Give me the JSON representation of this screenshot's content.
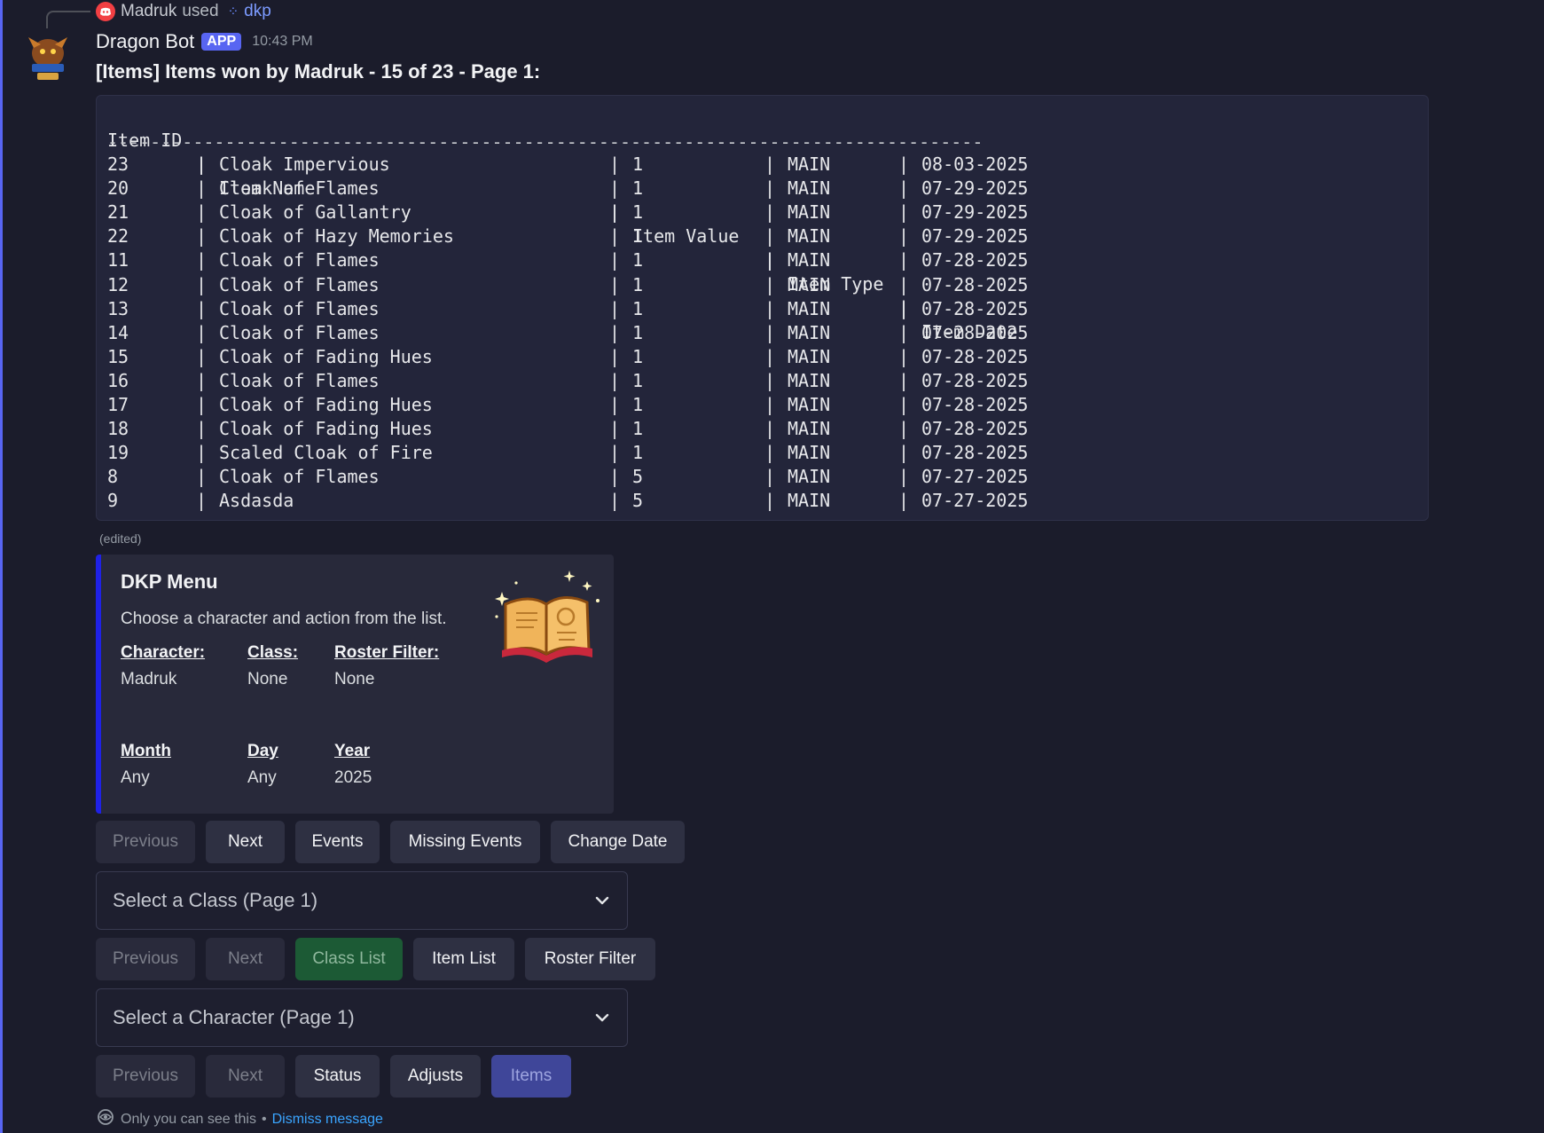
{
  "reply": {
    "user": "Madruk",
    "used_text": "used",
    "command": "dkp"
  },
  "message": {
    "bot_name": "Dragon Bot",
    "app_tag": "APP",
    "time": "10:43 PM",
    "title": "[Items] Items won by Madruk - 15 of 23 - Page 1:",
    "edited": "(edited)"
  },
  "table": {
    "headers": [
      "Item ID",
      "Item Name",
      "Item Value",
      "Item Type",
      "Item Date"
    ],
    "separator": "----------------------------------------------------------------------------------",
    "rows": [
      {
        "id": "23",
        "name": "Cloak Impervious",
        "value": "1",
        "type": "MAIN",
        "date": "08-03-2025"
      },
      {
        "id": "20",
        "name": "Cloak of Flames",
        "value": "1",
        "type": "MAIN",
        "date": "07-29-2025"
      },
      {
        "id": "21",
        "name": "Cloak of Gallantry",
        "value": "1",
        "type": "MAIN",
        "date": "07-29-2025"
      },
      {
        "id": "22",
        "name": "Cloak of Hazy Memories",
        "value": "1",
        "type": "MAIN",
        "date": "07-29-2025"
      },
      {
        "id": "11",
        "name": "Cloak of Flames",
        "value": "1",
        "type": "MAIN",
        "date": "07-28-2025"
      },
      {
        "id": "12",
        "name": "Cloak of Flames",
        "value": "1",
        "type": "MAIN",
        "date": "07-28-2025"
      },
      {
        "id": "13",
        "name": "Cloak of Flames",
        "value": "1",
        "type": "MAIN",
        "date": "07-28-2025"
      },
      {
        "id": "14",
        "name": "Cloak of Flames",
        "value": "1",
        "type": "MAIN",
        "date": "07-28-2025"
      },
      {
        "id": "15",
        "name": "Cloak of Fading Hues",
        "value": "1",
        "type": "MAIN",
        "date": "07-28-2025"
      },
      {
        "id": "16",
        "name": "Cloak of Flames",
        "value": "1",
        "type": "MAIN",
        "date": "07-28-2025"
      },
      {
        "id": "17",
        "name": "Cloak of Fading Hues",
        "value": "1",
        "type": "MAIN",
        "date": "07-28-2025"
      },
      {
        "id": "18",
        "name": "Cloak of Fading Hues",
        "value": "1",
        "type": "MAIN",
        "date": "07-28-2025"
      },
      {
        "id": "19",
        "name": "Scaled Cloak of Fire",
        "value": "1",
        "type": "MAIN",
        "date": "07-28-2025"
      },
      {
        "id": "8",
        "name": "Cloak of Flames",
        "value": "5",
        "type": "MAIN",
        "date": "07-27-2025"
      },
      {
        "id": "9",
        "name": "Asdasda",
        "value": "5",
        "type": "MAIN",
        "date": "07-27-2025"
      }
    ]
  },
  "embed": {
    "title": "DKP Menu",
    "description": "Choose a character and action from the list.",
    "accent_color": "#1f21e6",
    "fields": [
      {
        "name": "Character:",
        "value": "Madruk"
      },
      {
        "name": "Class:",
        "value": "None"
      },
      {
        "name": "Roster Filter:",
        "value": "None"
      },
      {
        "name": "Month",
        "value": "Any"
      },
      {
        "name": "Day",
        "value": "Any"
      },
      {
        "name": "Year",
        "value": "2025"
      }
    ],
    "thumbnail_icon": "open-spellbook-icon"
  },
  "row1": [
    "Previous",
    "Next",
    "Events",
    "Missing Events",
    "Change Date"
  ],
  "select_class": {
    "placeholder": "Select a Class (Page 1)"
  },
  "row2": [
    "Previous",
    "Next",
    "Class List",
    "Item List",
    "Roster Filter"
  ],
  "select_character": {
    "placeholder": "Select a Character (Page 1)"
  },
  "row3": [
    "Previous",
    "Next",
    "Status",
    "Adjusts",
    "Items"
  ],
  "footer": {
    "text": "Only you can see this",
    "bullet": "•",
    "link": "Dismiss message"
  },
  "colors": {
    "blurple": "#5865f2",
    "success": "#1c5a35",
    "link": "#3aa5ff"
  }
}
